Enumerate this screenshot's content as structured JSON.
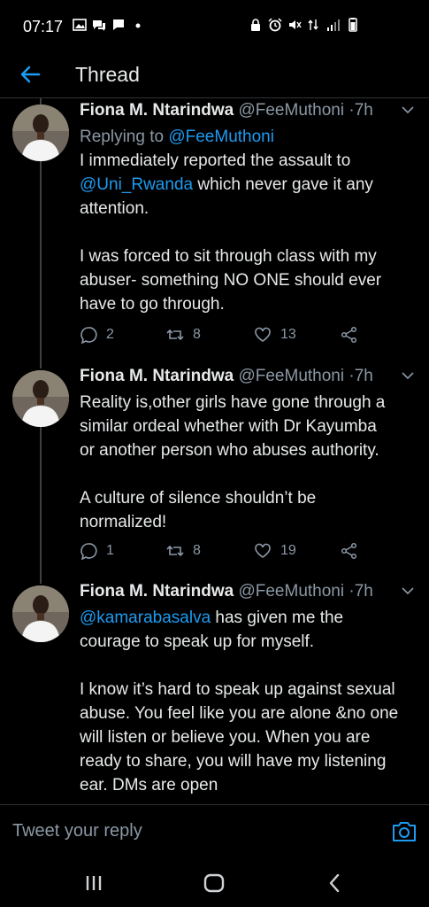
{
  "status_bar": {
    "time": "07:17"
  },
  "header": {
    "title": "Thread"
  },
  "tweets": [
    {
      "name": "Fiona M. Ntarindwa",
      "handle": "@FeeMuthoni",
      "time_sep": "·",
      "time": "7h",
      "replying_prefix": "Replying to",
      "replying_to": "@FeeMuthoni",
      "lines": [
        "I immediately reported the assault to",
        "",
        "attention.",
        "",
        "I was forced to sit through class with my",
        "abuser- something NO ONE should ever",
        "have to go through."
      ],
      "mention": "@Uni_Rwanda",
      "mention_rest": " which never gave it any",
      "replies": "2",
      "retweets": "8",
      "likes": "13"
    },
    {
      "name": "Fiona M. Ntarindwa",
      "handle": "@FeeMuthoni",
      "time_sep": "·",
      "time": "7h",
      "lines": [
        "Reality is,other girls have gone through a",
        "similar ordeal whether with Dr Kayumba",
        "or another person who abuses authority.",
        "",
        "A culture of silence shouldn’t be",
        "normalized!"
      ],
      "replies": "1",
      "retweets": "8",
      "likes": "19"
    },
    {
      "name": "Fiona M. Ntarindwa",
      "handle": "@FeeMuthoni",
      "time_sep": "·",
      "time": "7h",
      "mention": "@kamarabasalva",
      "mention_rest": " has given me the",
      "lines": [
        "courage to speak up for myself.",
        "",
        "I know it’s hard to speak up against sexual",
        "abuse. You feel like you are alone &no one",
        "will listen or believe you. When you are",
        "ready to share, you will have my listening",
        "ear. DMs are open"
      ]
    }
  ],
  "compose": {
    "placeholder": "Tweet your reply"
  },
  "colors": {
    "accent": "#1d9bf0",
    "muted": "#8b98a5",
    "divider": "#2f3336"
  }
}
